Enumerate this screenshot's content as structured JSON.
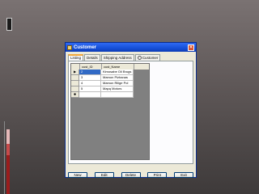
{
  "window": {
    "title": "Customer",
    "close_icon": "close-icon",
    "title_icon": "form-icon"
  },
  "tabs": [
    {
      "label": "Listing",
      "active": true
    },
    {
      "label": "Details",
      "active": false
    },
    {
      "label": "Shipping Address",
      "active": false
    },
    {
      "label": "Customer",
      "active": false,
      "radio": true
    }
  ],
  "grid": {
    "columns": [
      "cust_ID",
      "cust_Name"
    ],
    "rows": [
      {
        "indicator": "▶",
        "cust_ID": "2",
        "cust_Name": "Kimosabe Oil Brugs"
      },
      {
        "indicator": "",
        "cust_ID": "3",
        "cust_Name": "Mamon Pizhanas"
      },
      {
        "indicator": "",
        "cust_ID": "4",
        "cust_Name": "Mamon Rilige Pol"
      },
      {
        "indicator": "",
        "cust_ID": "5",
        "cust_Name": "Mapq Motors"
      },
      {
        "indicator": "✱",
        "cust_ID": "",
        "cust_Name": ""
      }
    ],
    "selected_row": 0
  },
  "buttons": {
    "new": "New",
    "edit": "Edit",
    "delete": "Delete",
    "print": "Print",
    "exit": "Exit"
  },
  "colors": {
    "title_bar": "#1650d8",
    "selection": "#316ac5",
    "accent_stripe": "#9b1c1c"
  }
}
